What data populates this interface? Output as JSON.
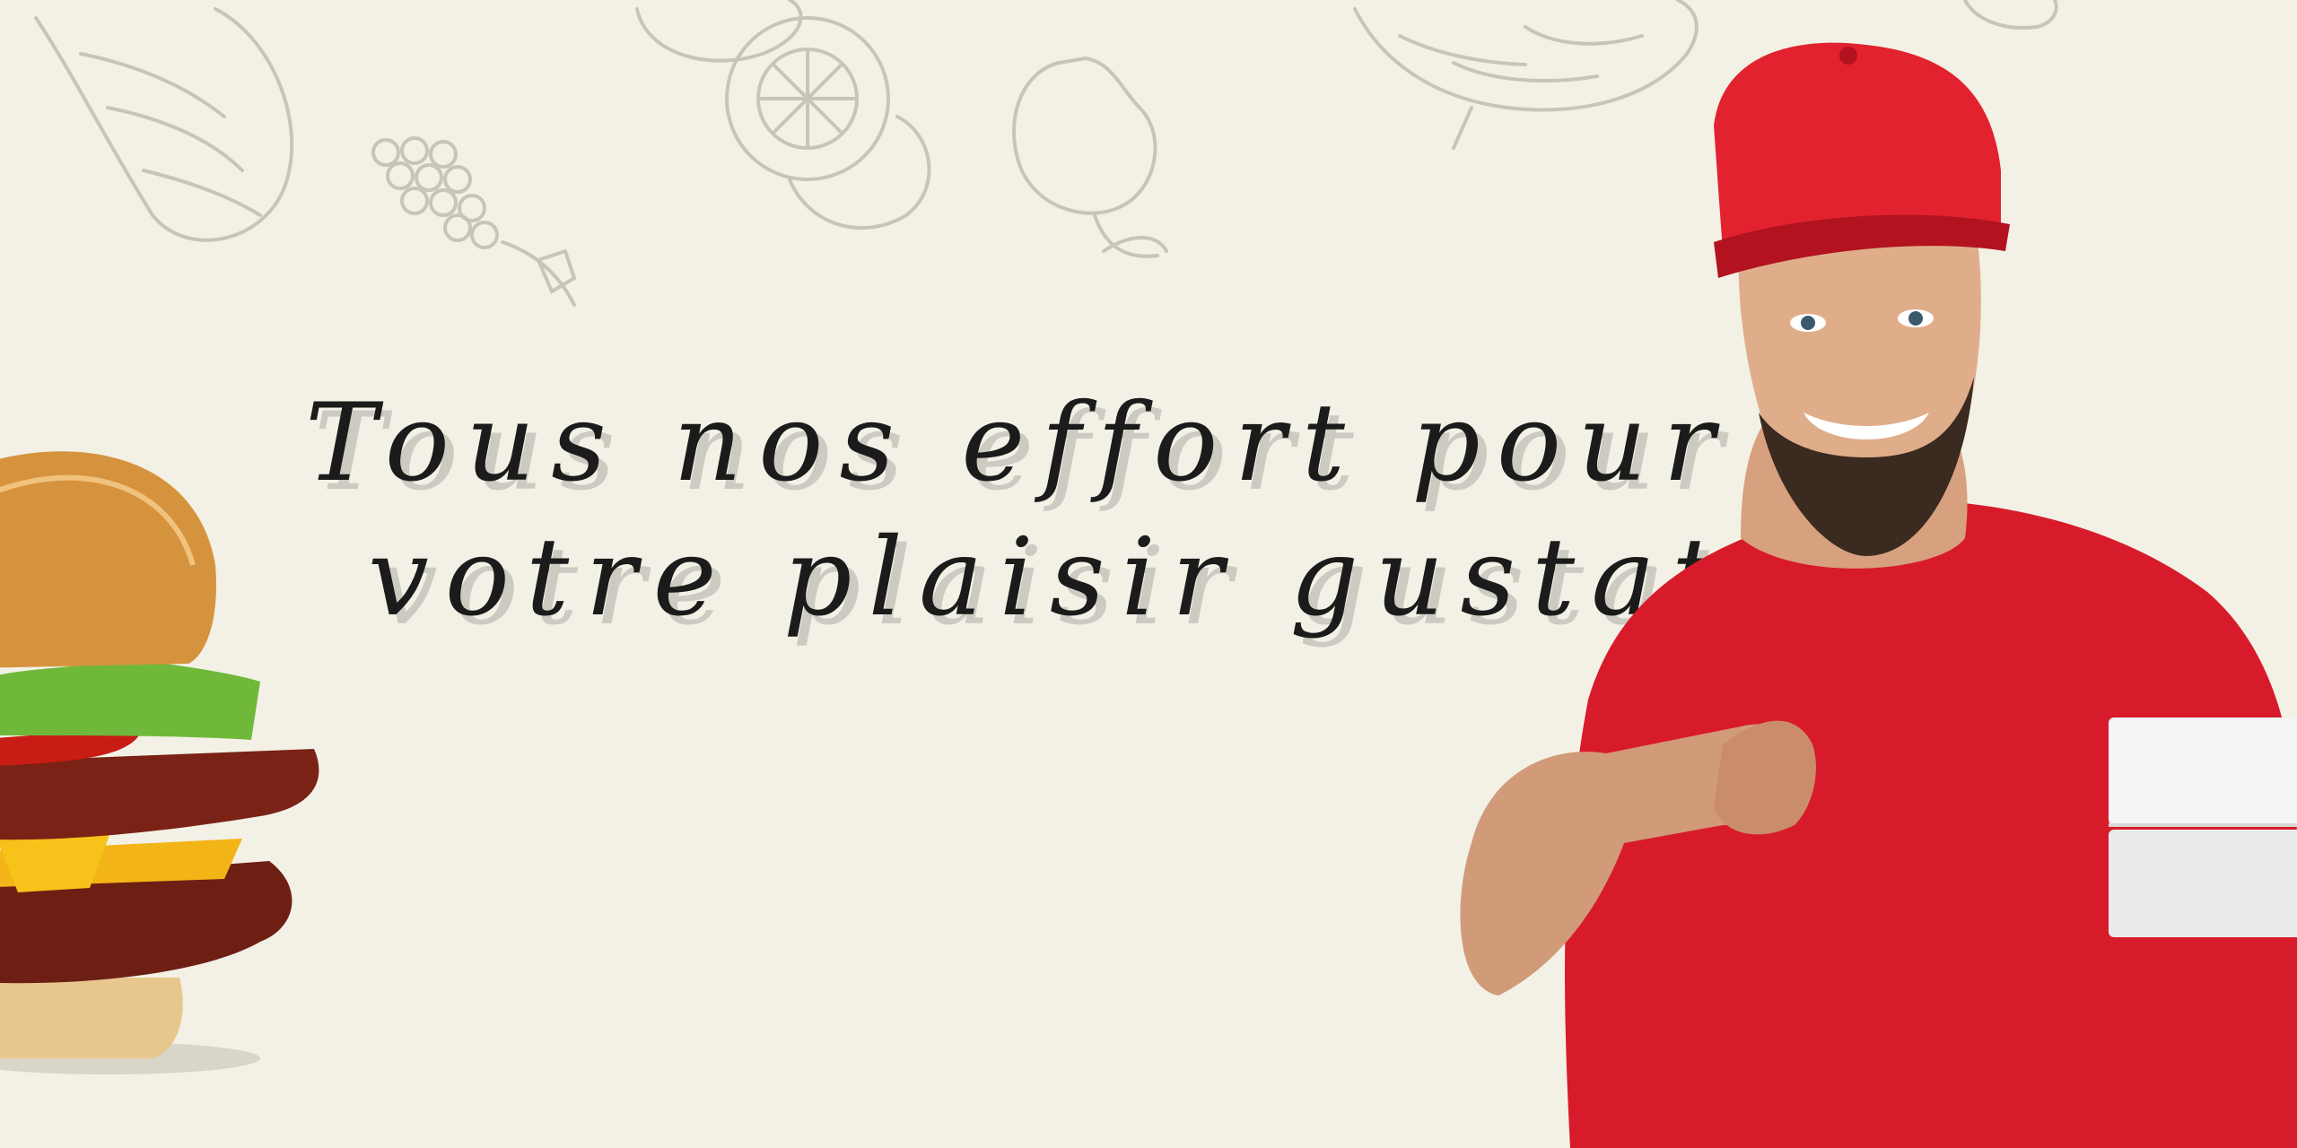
{
  "banner": {
    "tagline": {
      "line1": "Tous nos effort pour",
      "line2": "votre plaisir gustatif"
    }
  },
  "icons": {
    "background": [
      "croissant-sketch",
      "grape-bunch-sketch",
      "pastry-sketch",
      "pear-sketch",
      "vegetable-sketch"
    ],
    "foreground": [
      "burger-image",
      "delivery-man-image"
    ]
  },
  "colors": {
    "background": "#f3f1e6",
    "text": "#1b1b1b",
    "accent_red": "#d81b2a",
    "sketch": "#cfcbbd"
  }
}
